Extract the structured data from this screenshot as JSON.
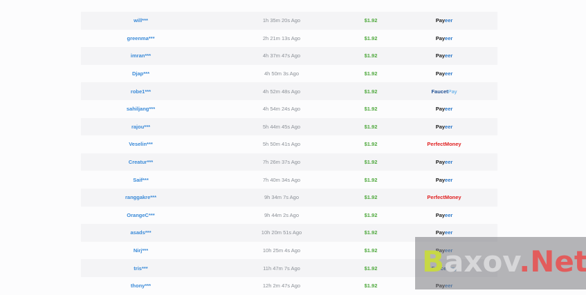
{
  "payouts": [
    {
      "user": "will***",
      "time": "1h 35m 20s Ago",
      "amount": "$1.92",
      "method": "payeer"
    },
    {
      "user": "greenma***",
      "time": "2h 21m 13s Ago",
      "amount": "$1.92",
      "method": "payeer"
    },
    {
      "user": "imran***",
      "time": "4h 37m 47s Ago",
      "amount": "$1.92",
      "method": "payeer"
    },
    {
      "user": "Djap***",
      "time": "4h 50m 3s Ago",
      "amount": "$1.92",
      "method": "payeer"
    },
    {
      "user": "robe1***",
      "time": "4h 52m 48s Ago",
      "amount": "$1.92",
      "method": "faucetpay"
    },
    {
      "user": "sahiljang***",
      "time": "4h 54m 24s Ago",
      "amount": "$1.92",
      "method": "payeer"
    },
    {
      "user": "rajou***",
      "time": "5h 44m 45s Ago",
      "amount": "$1.92",
      "method": "payeer"
    },
    {
      "user": "Veselin***",
      "time": "5h 50m 41s Ago",
      "amount": "$1.92",
      "method": "perfectmoney"
    },
    {
      "user": "Creatur***",
      "time": "7h 26m 37s Ago",
      "amount": "$1.92",
      "method": "payeer"
    },
    {
      "user": "Saif***",
      "time": "7h 40m 34s Ago",
      "amount": "$1.92",
      "method": "payeer"
    },
    {
      "user": "ranggakre***",
      "time": "9h 34m 7s Ago",
      "amount": "$1.92",
      "method": "perfectmoney"
    },
    {
      "user": "OrangeC***",
      "time": "9h 44m 2s Ago",
      "amount": "$1.92",
      "method": "payeer"
    },
    {
      "user": "asads***",
      "time": "10h 20m 51s Ago",
      "amount": "$1.92",
      "method": "payeer"
    },
    {
      "user": "Nirj***",
      "time": "10h 25m 4s Ago",
      "amount": "$1.92",
      "method": "payeer"
    },
    {
      "user": "tris***",
      "time": "11h 47m 7s Ago",
      "amount": "$1.92",
      "method": "faucetpay"
    },
    {
      "user": "thony***",
      "time": "12h 2m 47s Ago",
      "amount": "$1.92",
      "method": "payeer"
    }
  ],
  "methods": {
    "payeer": {
      "part1": "Pay",
      "part2": "eer"
    },
    "faucetpay": {
      "part1": "Faucet",
      "part2": "Pay"
    },
    "perfectmoney": {
      "part1": "PerfectMoney",
      "part2": ""
    }
  },
  "watermark": {
    "b": "B",
    "mid": "axov",
    "dot": ".",
    "net": "Net"
  },
  "colors": {
    "username": "#3a8ad8",
    "time": "#8a8f96",
    "amount": "#4ea83c",
    "payeer_blue": "#2a77c9",
    "perfectmoney_red": "#e02020"
  }
}
